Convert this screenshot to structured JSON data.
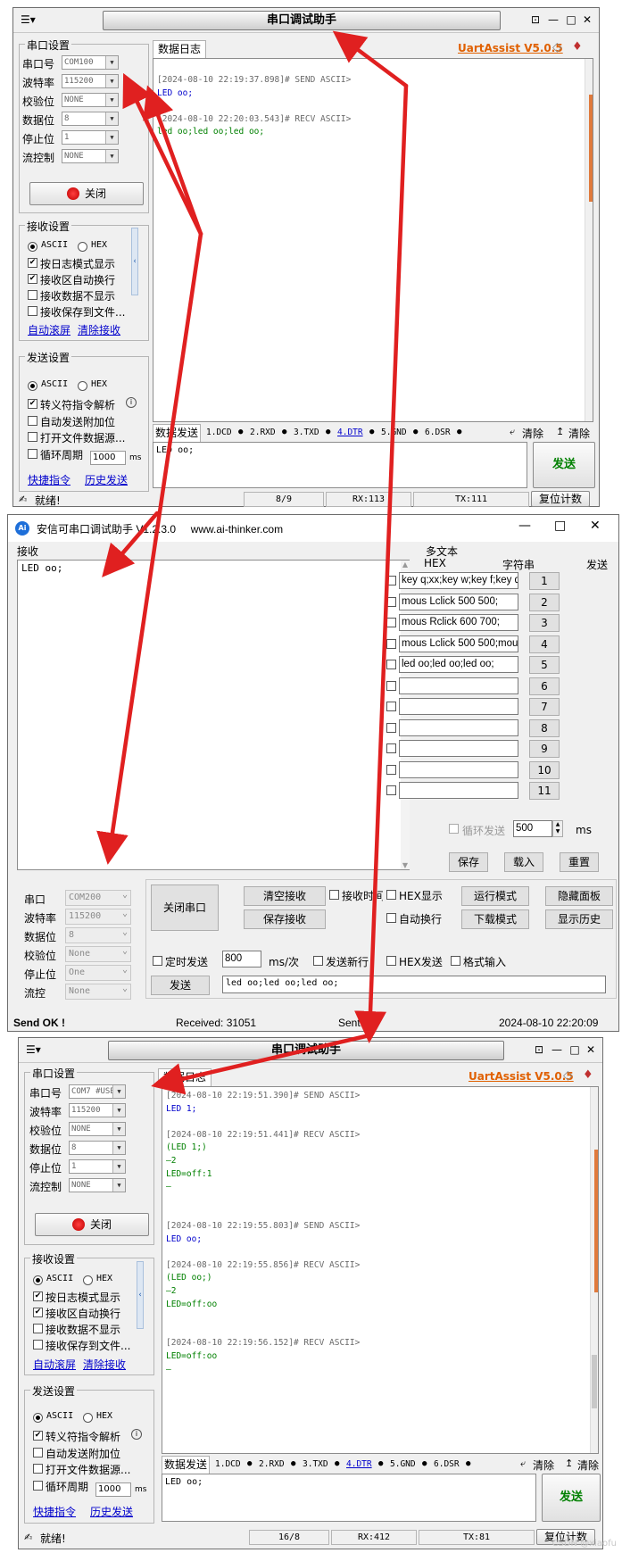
{
  "uart1": {
    "title": "串口调试助手",
    "brand": "UartAssist V5.0.5",
    "serial_group": "串口设置",
    "labels": [
      "串口号",
      "波特率",
      "校验位",
      "数据位",
      "停止位",
      "流控制"
    ],
    "values": [
      "COM100",
      "115200",
      "NONE",
      "8",
      "1",
      "NONE"
    ],
    "close_btn": "关闭",
    "recv_group": "接收设置",
    "recv_ascii": "ASCII",
    "recv_hex": "HEX",
    "recv_opts": [
      "按日志模式显示",
      "接收区自动换行",
      "接收数据不显示",
      "接收保存到文件..."
    ],
    "recv_checked": [
      true,
      true,
      false,
      false
    ],
    "auto_scroll": "自动滚屏",
    "clear_recv": "清除接收",
    "send_group": "发送设置",
    "send_ascii": "ASCII",
    "send_hex": "HEX",
    "send_opts": [
      "转义符指令解析",
      "自动发送附加位",
      "打开文件数据源...",
      "循环周期"
    ],
    "send_checked": [
      true,
      false,
      false,
      false
    ],
    "period": "1000",
    "period_unit": "ms",
    "quick_cmd": "快捷指令",
    "history": "历史发送",
    "log_tab": "数据日志",
    "log": [
      {
        "t": "[2024-08-10 22:19:37.898]# SEND ASCII>",
        "k": "hdr"
      },
      {
        "t": "LED oo;",
        "k": "snd"
      },
      {
        "t": "",
        "k": "hdr"
      },
      {
        "t": "[2024-08-10 22:20:03.543]# RECV ASCII>",
        "k": "hdr"
      },
      {
        "t": "led oo;led oo;led oo;",
        "k": "rcv"
      }
    ],
    "send_tab": "数据发送",
    "pins": [
      "1.DCD",
      "2.RXD",
      "3.TXD",
      "4.DTR",
      "5.GND",
      "6.DSR"
    ],
    "clear1": "清除",
    "clear2": "清除",
    "send_text": "LED oo;",
    "send_btn": "发送",
    "status_ready": "就绪!",
    "status_count": "8/9",
    "status_rx": "RX:113",
    "status_tx": "TX:111",
    "reset_count": "复位计数"
  },
  "ai": {
    "title": "安信可串口调试助手 V1.2.3.0     www.ai-thinker.com",
    "recv_label": "接收",
    "recv_text": "LED oo;",
    "multi_title": "多文本",
    "col_hex": "HEX",
    "col_str": "字符串",
    "col_send": "发送",
    "rows": [
      {
        "s": "key q;xx;key w;key f;key q;k",
        "n": "1"
      },
      {
        "s": "mous Lclick 500 500;",
        "n": "2"
      },
      {
        "s": "mous Rclick 600 700;",
        "n": "3"
      },
      {
        "s": "mous Lclick 500 500;mou",
        "n": "4"
      },
      {
        "s": "led oo;led oo;led oo;",
        "n": "5"
      },
      {
        "s": "",
        "n": "6"
      },
      {
        "s": "",
        "n": "7"
      },
      {
        "s": "",
        "n": "8"
      },
      {
        "s": "",
        "n": "9"
      },
      {
        "s": "",
        "n": "10"
      },
      {
        "s": "",
        "n": "11"
      }
    ],
    "loop_send": "循环发送",
    "loop_ms": "500",
    "ms": "ms",
    "save": "保存",
    "load": "载入",
    "reset": "重置",
    "port_labels": [
      "串口",
      "波特率",
      "数据位",
      "校验位",
      "停止位",
      "流控"
    ],
    "port_values": [
      "COM200",
      "115200",
      "8",
      "None",
      "One",
      "None"
    ],
    "close_port": "关闭串口",
    "clear_recv": "清空接收",
    "save_recv": "保存接收",
    "recv_time": "接收时间",
    "hex_show": "HEX显示",
    "run_mode": "运行模式",
    "hide_panel": "隐藏面板",
    "auto_wrap": "自动换行",
    "dl_mode": "下载模式",
    "show_hist": "显示历史",
    "timed_send": "定时发送",
    "timed_val": "800",
    "ms_per": "ms/次",
    "send_newline": "发送新行",
    "hex_send": "HEX发送",
    "fmt_input": "格式输入",
    "send_btn": "发送",
    "send_text": "led oo;led oo;led oo;",
    "st_ok": "Send OK !",
    "st_recv": "Received: 31051",
    "st_sent": "Sent:",
    "st_time": "2024-08-10 22:20:09"
  },
  "uart2": {
    "title": "串口调试助手",
    "brand": "UartAssist V5.0.5",
    "serial_group": "串口设置",
    "labels": [
      "串口号",
      "波特率",
      "校验位",
      "数据位",
      "停止位",
      "流控制"
    ],
    "values": [
      "COM7 #USB",
      "115200",
      "NONE",
      "8",
      "1",
      "NONE"
    ],
    "close_btn": "关闭",
    "recv_group": "接收设置",
    "recv_opts": [
      "按日志模式显示",
      "接收区自动换行",
      "接收数据不显示",
      "接收保存到文件..."
    ],
    "auto_scroll": "自动滚屏",
    "clear_recv": "清除接收",
    "send_group": "发送设置",
    "send_opts": [
      "转义符指令解析",
      "自动发送附加位",
      "打开文件数据源...",
      "循环周期"
    ],
    "period": "1000",
    "quick_cmd": "快捷指令",
    "history": "历史发送",
    "log": [
      {
        "t": "[2024-08-10 22:19:51.390]# SEND ASCII>",
        "k": "hdr"
      },
      {
        "t": "LED 1;",
        "k": "snd"
      },
      {
        "t": "",
        "k": "hdr"
      },
      {
        "t": "[2024-08-10 22:19:51.441]# RECV ASCII>",
        "k": "hdr"
      },
      {
        "t": "(LED 1;)",
        "k": "rcv"
      },
      {
        "t": "—2",
        "k": "rcv"
      },
      {
        "t": "LED=off:1",
        "k": "rcv"
      },
      {
        "t": "—",
        "k": "rcv"
      },
      {
        "t": "",
        "k": "hdr"
      },
      {
        "t": "",
        "k": "hdr"
      },
      {
        "t": "[2024-08-10 22:19:55.803]# SEND ASCII>",
        "k": "hdr"
      },
      {
        "t": "LED oo;",
        "k": "snd"
      },
      {
        "t": "",
        "k": "hdr"
      },
      {
        "t": "[2024-08-10 22:19:55.856]# RECV ASCII>",
        "k": "hdr"
      },
      {
        "t": "(LED oo;)",
        "k": "rcv"
      },
      {
        "t": "—2",
        "k": "rcv"
      },
      {
        "t": "LED=off:oo",
        "k": "rcv"
      },
      {
        "t": "",
        "k": "hdr"
      },
      {
        "t": "",
        "k": "hdr"
      },
      {
        "t": "[2024-08-10 22:19:56.152]# RECV ASCII>",
        "k": "hdr"
      },
      {
        "t": "LED=off:oo",
        "k": "rcv"
      },
      {
        "t": "—",
        "k": "rcv"
      }
    ],
    "send_tab": "数据发送",
    "send_text": "LED oo;",
    "send_btn": "发送",
    "status_ready": "就绪!",
    "status_count": "16/8",
    "status_rx": "RX:412",
    "status_tx": "TX:81",
    "reset_count": "复位计数"
  },
  "watermark": "CSDN @xiaofu"
}
